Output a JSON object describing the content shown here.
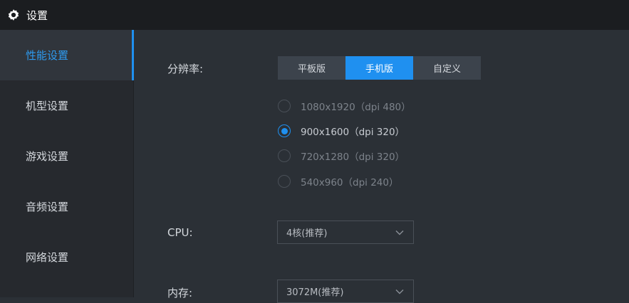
{
  "window": {
    "title": "设置"
  },
  "sidebar": {
    "items": [
      {
        "label": "性能设置",
        "active": true
      },
      {
        "label": "机型设置",
        "active": false
      },
      {
        "label": "游戏设置",
        "active": false
      },
      {
        "label": "音频设置",
        "active": false
      },
      {
        "label": "网络设置",
        "active": false
      }
    ]
  },
  "resolution": {
    "label": "分辨率:",
    "modes": [
      {
        "label": "平板版",
        "active": false
      },
      {
        "label": "手机版",
        "active": true
      },
      {
        "label": "自定义",
        "active": false
      }
    ],
    "options": [
      {
        "label": "1080x1920（dpi 480）",
        "checked": false
      },
      {
        "label": "900x1600（dpi 320）",
        "checked": true
      },
      {
        "label": "720x1280（dpi 320）",
        "checked": false
      },
      {
        "label": "540x960（dpi 240）",
        "checked": false
      }
    ]
  },
  "cpu": {
    "label": "CPU:",
    "value": "4核(推荐)"
  },
  "memory": {
    "label": "内存:",
    "value": "3072M(推荐)"
  },
  "colors": {
    "accent": "#1f90f0",
    "background": "#2b3036",
    "sidebar": "#26292e",
    "titlebar": "#1b1d20"
  },
  "icons": {
    "title": "gear-icon",
    "select": "chevron-down-icon"
  }
}
